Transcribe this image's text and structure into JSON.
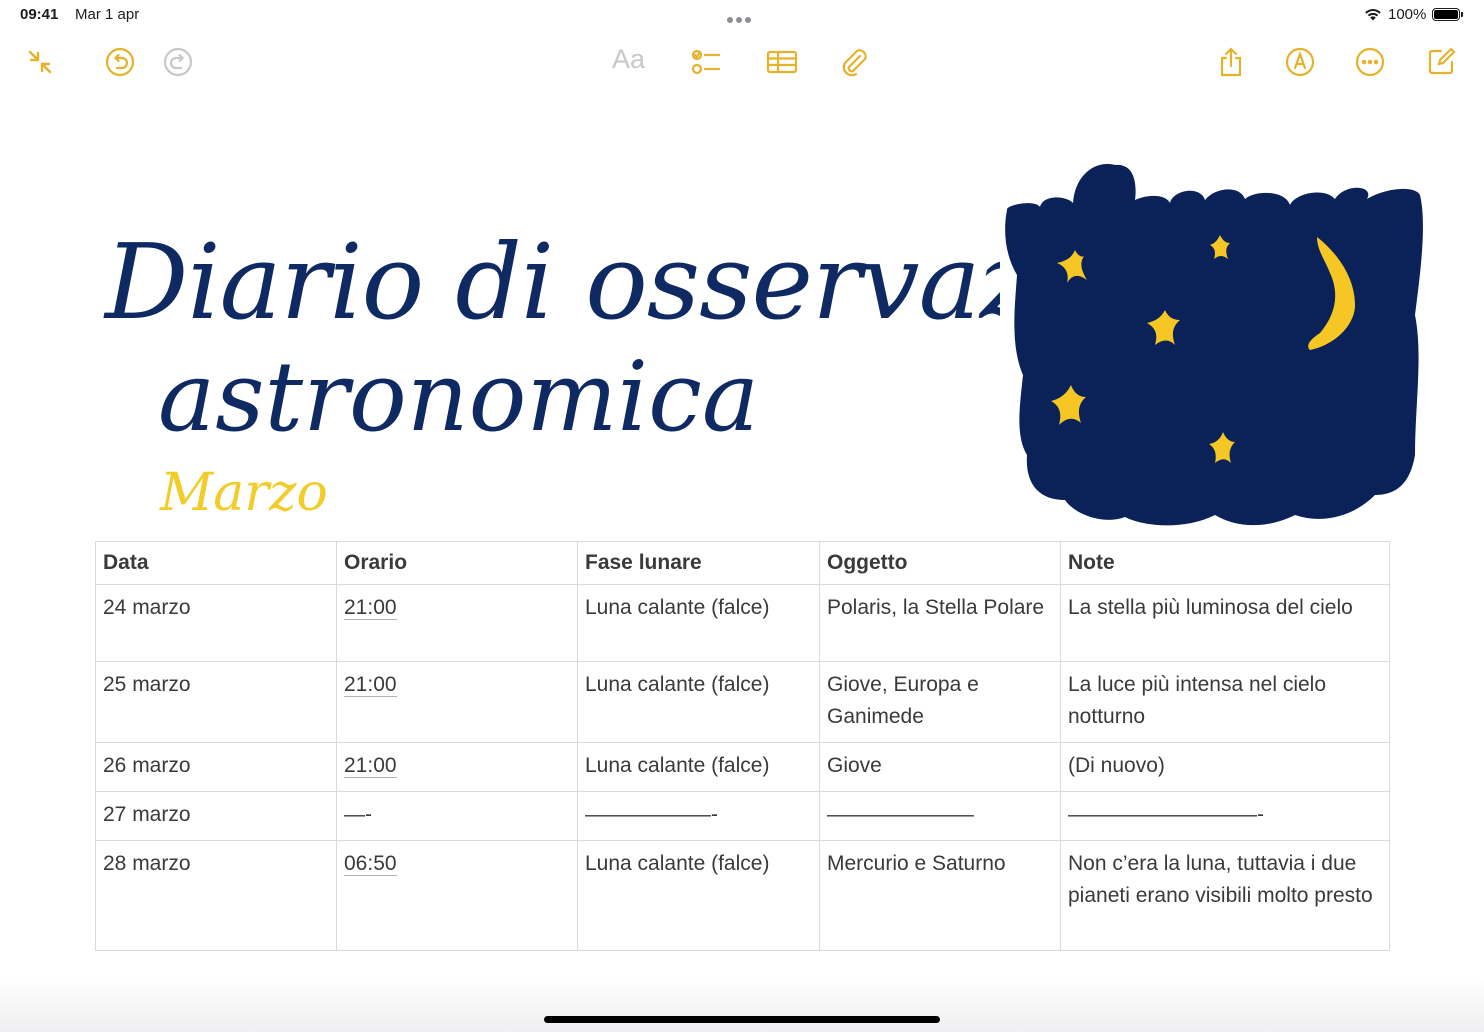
{
  "status_bar": {
    "time": "09:41",
    "date": "Mar 1 apr",
    "battery": "100%"
  },
  "toolbar": {
    "format_label": "Aa",
    "icons": [
      "collapse-icon",
      "undo-icon",
      "redo-icon",
      "checklist-icon",
      "table-icon",
      "attachment-icon",
      "share-icon",
      "markup-icon",
      "more-icon",
      "compose-icon"
    ],
    "accent_color": "#E5B22B",
    "disabled_color": "#C7C7CC"
  },
  "drawing": {
    "title_line1": "Diario di osservazione",
    "title_line2": "astronomica",
    "subtitle": "Marzo",
    "title_color": "#0F2A63",
    "subtitle_color": "#F2CC2A",
    "sky_color": "#0A2258",
    "star_color": "#F5C624"
  },
  "table": {
    "headers": [
      "Data",
      "Orario",
      "Fase lunare",
      "Oggetto",
      "Note"
    ],
    "rows": [
      [
        "24 marzo",
        "21:00",
        "Luna calante (falce)",
        "Polaris, la Stella Polare",
        "La stella più luminosa del cielo"
      ],
      [
        "25 marzo",
        "21:00",
        "Luna calante (falce)",
        "Giove, Europa e Ganimede",
        "La luce più intensa nel cielo notturno"
      ],
      [
        "26 marzo",
        "21:00",
        "Luna calante (falce)",
        "Giove",
        "(Di nuovo)"
      ],
      [
        "27 marzo",
        "—-",
        "——————-",
        "———————",
        "—————————-"
      ],
      [
        "28 marzo",
        "06:50",
        "Luna calante (falce)",
        "Mercurio e Saturno",
        "Non c’era la luna, tuttavia i due pianeti erano visibili molto presto"
      ]
    ]
  }
}
